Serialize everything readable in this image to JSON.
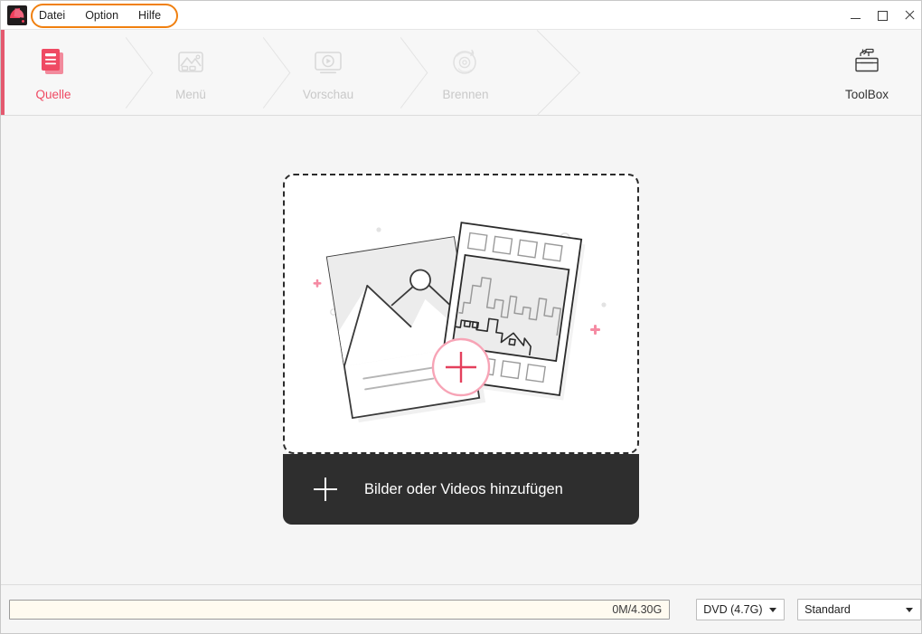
{
  "window": {
    "logo_icon": "app-logo-icon",
    "controls": [
      {
        "name": "minimize",
        "icon": "minimize-icon"
      },
      {
        "name": "maximize",
        "icon": "maximize-icon"
      },
      {
        "name": "close",
        "icon": "close-icon"
      }
    ]
  },
  "menubar": {
    "items": [
      {
        "label": "Datei"
      },
      {
        "label": "Option"
      },
      {
        "label": "Hilfe"
      }
    ],
    "annotation_color": "#f08010"
  },
  "nav": {
    "accent_color": "#e4596f",
    "active_color": "#ef4a63",
    "inactive_color": "#c9c9c9",
    "steps": [
      {
        "label": "Quelle",
        "icon": "document-pages-icon",
        "active": true
      },
      {
        "label": "Menü",
        "icon": "image-picture-icon",
        "active": false
      },
      {
        "label": "Vorschau",
        "icon": "monitor-play-icon",
        "active": false
      },
      {
        "label": "Brennen",
        "icon": "disc-flame-icon",
        "active": false
      }
    ],
    "toolbox": {
      "label": "ToolBox",
      "icon": "toolbox-icon"
    }
  },
  "main": {
    "dropzone": {
      "name": "media-dropzone",
      "illustration": "photo-and-filmstrip-illustration",
      "plus_badge_color": "#ef4a63"
    },
    "add_button": {
      "label": "Bilder oder Videos hinzufügen",
      "icon": "plus-icon",
      "background": "#2e2e2e"
    }
  },
  "bottom": {
    "progress": {
      "name": "capacity-progress-bar",
      "caption": "0M/4.30G",
      "fill_percent": 0,
      "track_color": "#fffbf0"
    },
    "disc_select": {
      "name": "disc-type-select",
      "value": "DVD (4.7G)"
    },
    "quality_select": {
      "name": "quality-select",
      "value": "Standard"
    }
  }
}
